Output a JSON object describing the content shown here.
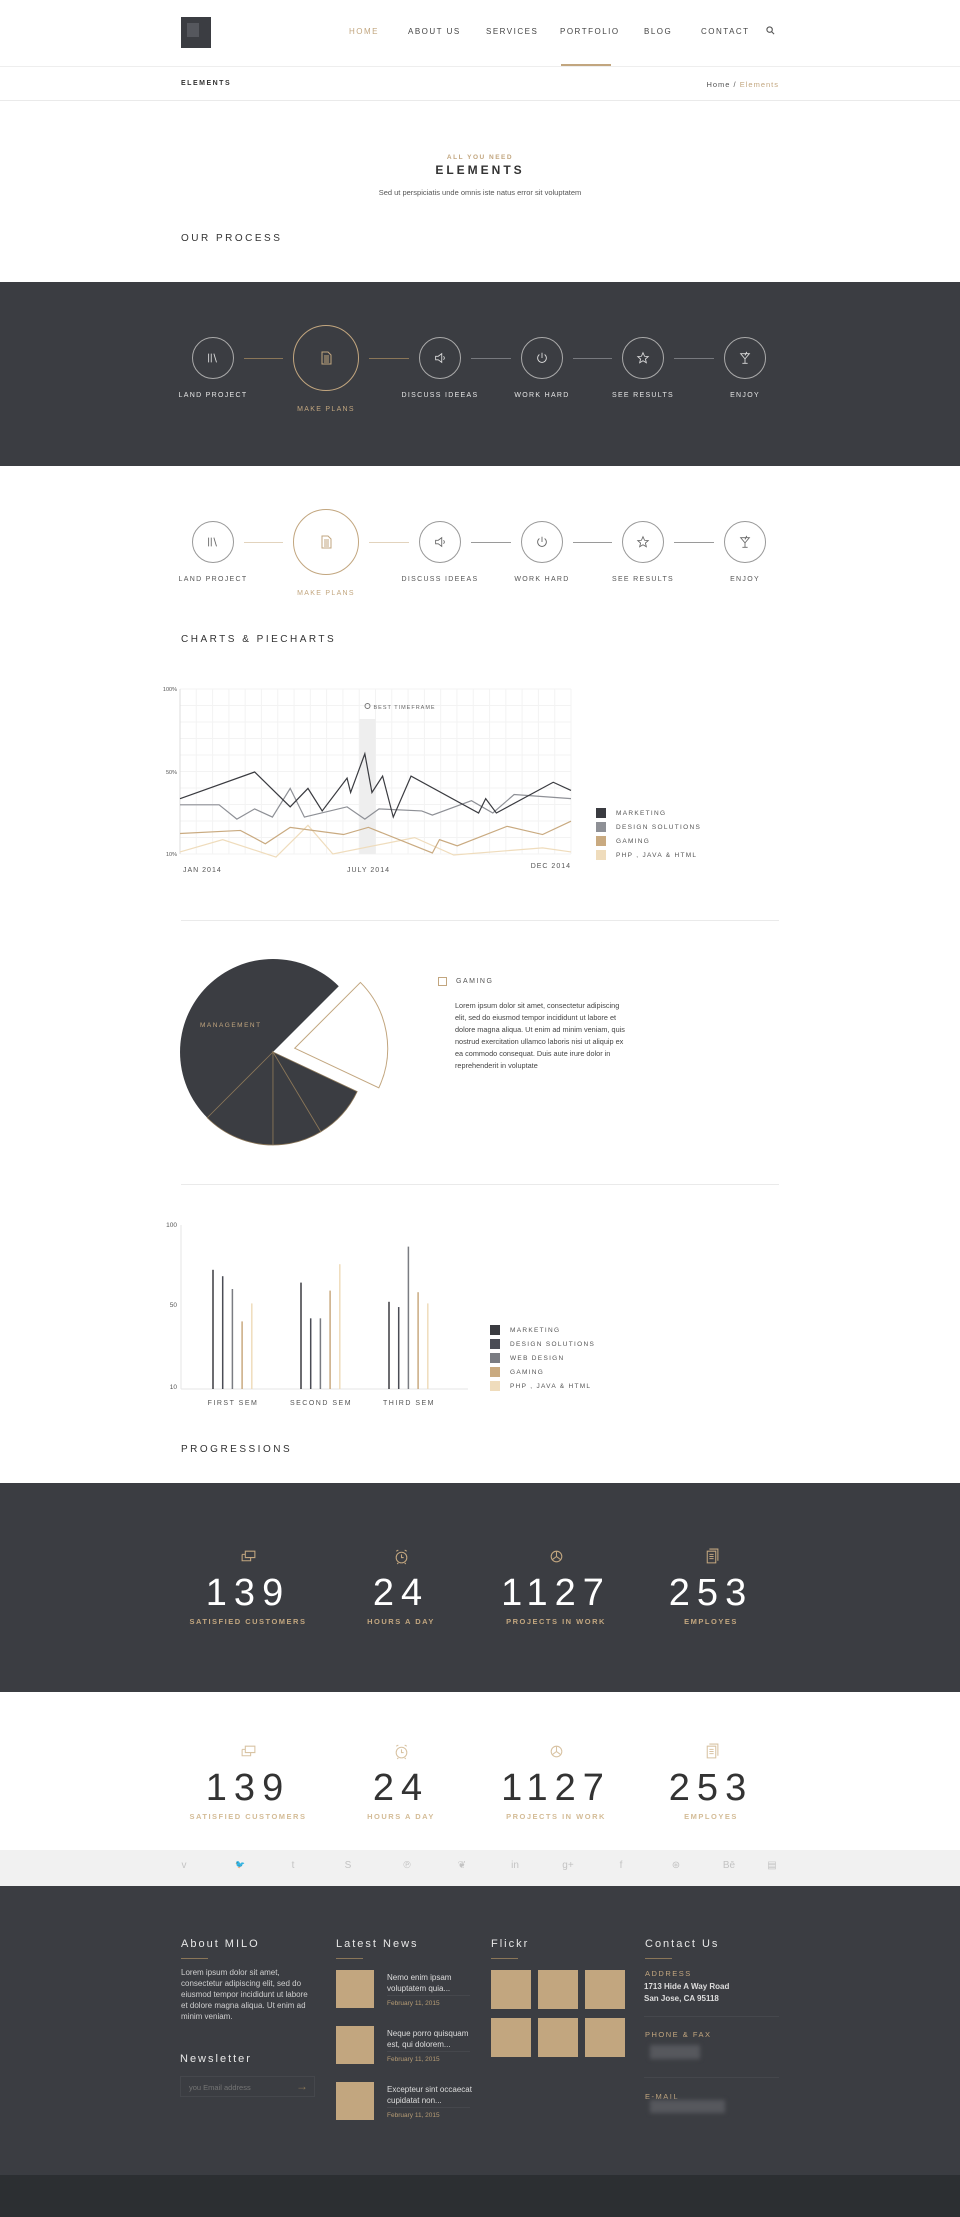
{
  "header": {
    "nav": [
      {
        "label": "HOME",
        "active": true
      },
      {
        "label": "ABOUT US"
      },
      {
        "label": "SERVICES"
      },
      {
        "label": "PORTFOLIO",
        "underlined": true
      },
      {
        "label": "BLOG"
      },
      {
        "label": "CONTACT"
      }
    ],
    "search_icon": "search-icon"
  },
  "breadcrumb": {
    "title": "ELEMENTS",
    "home": "Home",
    "separator": " / ",
    "current": "Elements"
  },
  "hero": {
    "kicker": "ALL YOU NEED",
    "title": "ELEMENTS",
    "subtitle": "Sed ut perspiciatis unde omnis iste natus error sit voluptatem"
  },
  "process": {
    "title": "OUR PROCESS",
    "steps": [
      {
        "label": "LAND PROJECT",
        "icon": "books-icon"
      },
      {
        "label": "MAKE PLANS",
        "icon": "document-icon",
        "active": true
      },
      {
        "label": "DISCUSS IDEEAS",
        "icon": "speaker-icon"
      },
      {
        "label": "WORK HARD",
        "icon": "power-icon"
      },
      {
        "label": "SEE RESULTS",
        "icon": "star-icon"
      },
      {
        "label": "ENJOY",
        "icon": "cocktail-icon"
      }
    ]
  },
  "charts_title": "CHARTS & PIECHARTS",
  "colors": {
    "dark": "#3b3d42",
    "accent": "#c2a67f",
    "marketing": "#3a3b40",
    "design": "#8e9096",
    "gaming": "#c9aa80",
    "php": "#efdcbc"
  },
  "chart_data": [
    {
      "type": "line",
      "ylabels": [
        "100%",
        "50%",
        "10%"
      ],
      "yticks": [
        100,
        50,
        10
      ],
      "xlabels": [
        "JAN 2014",
        "JULY 2014",
        "DEC 2014"
      ],
      "xlim": [
        0,
        11
      ],
      "grid": true,
      "legend": "right",
      "annotation": {
        "label": "BEST TIMEFRAME",
        "x_range": [
          5.05,
          5.5
        ]
      },
      "series": [
        {
          "name": "MARKETING",
          "color": "#3a3b40",
          "x": [
            0,
            2.1,
            3.1,
            3.6,
            4.0,
            4.7,
            4.8,
            5.2,
            5.4,
            5.7,
            6.0,
            6.5,
            8.4,
            8.6,
            8.9,
            10.5,
            11
          ],
          "y": [
            37,
            50,
            33,
            42,
            31,
            47,
            40,
            61,
            40,
            48,
            28,
            48,
            30,
            37,
            30,
            45,
            41
          ]
        },
        {
          "name": "DESIGN SOLUTIONS",
          "color": "#8e9096",
          "x": [
            0,
            1.1,
            1.6,
            2.1,
            2.6,
            3.1,
            3.5,
            4.7,
            5.2,
            5.6,
            6.8,
            7.1,
            8.2,
            8.8,
            9.4,
            11
          ],
          "y": [
            34,
            34,
            27,
            32,
            28,
            42,
            28,
            33,
            27,
            32,
            31,
            29,
            36,
            30,
            39,
            37
          ]
        },
        {
          "name": "GAMING",
          "color": "#c9aa80",
          "x": [
            0,
            1.7,
            2.4,
            3.1,
            4.6,
            5.3,
            7.1,
            7.3,
            7.8,
            9.2,
            10.2,
            11
          ],
          "y": [
            20,
            21.5,
            15,
            23,
            19.5,
            23,
            10.5,
            17,
            14,
            23.5,
            19.5,
            26
          ]
        },
        {
          "name": "PHP , JAVA & HTML",
          "color": "#efdcbc",
          "x": [
            0,
            1.2,
            2.7,
            3.6,
            4.3,
            6.6,
            7.7,
            10.2,
            11
          ],
          "y": [
            11,
            17,
            8.5,
            24,
            10,
            18,
            9.5,
            13,
            11
          ]
        }
      ]
    },
    {
      "type": "pie",
      "slices": [
        {
          "label": "MANAGEMENT",
          "value": 50,
          "color": "#3b3d42"
        },
        {
          "label": "",
          "value": 12.5,
          "color": "#3b3d42"
        },
        {
          "label": "",
          "value": 8.6,
          "color": "#3b3d42"
        },
        {
          "label": "",
          "value": 9.4,
          "color": "#3b3d42"
        },
        {
          "label": "GAMING",
          "value": 19.5,
          "color": "#ffffff",
          "exploded": true
        }
      ],
      "legend": {
        "label": "GAMING",
        "text": "Lorem ipsum dolor sit amet, consectetur adipiscing elit, sed do eiusmod tempor incididunt ut labore et dolore magna aliqua. Ut enim ad minim veniam, quis nostrud exercitation ullamco laboris nisi ut aliquip ex ea commodo consequat. Duis aute irure dolor in reprehenderit in voluptate"
      }
    },
    {
      "type": "bar",
      "categories": [
        "FIRST SEM",
        "SECOND SEM",
        "THIRD SEM"
      ],
      "ylabels": [
        "100",
        "50",
        "10"
      ],
      "yticks": [
        100,
        50,
        10
      ],
      "legend": "right",
      "series": [
        {
          "name": "MARKETING",
          "color": "#3a3b40",
          "values": [
            72,
            64,
            52
          ]
        },
        {
          "name": "DESIGN SOLUTIONS",
          "color": "#4a4c55",
          "values": [
            68,
            43.5,
            49
          ]
        },
        {
          "name": "WEB DESIGN",
          "color": "#7a7c82",
          "values": [
            60,
            43.5,
            86.5
          ]
        },
        {
          "name": "GAMING",
          "color": "#c9aa80",
          "values": [
            42,
            59,
            58
          ]
        },
        {
          "name": "PHP , JAVA & HTML",
          "color": "#efdcbc",
          "values": [
            51,
            75.5,
            51
          ]
        }
      ]
    }
  ],
  "progressions": {
    "title": "PROGRESSIONS",
    "stats": [
      {
        "value": "139",
        "label": "SATISFIED CUSTOMERS",
        "icon": "chat-icon"
      },
      {
        "value": "24",
        "label": "HOURS A DAY",
        "icon": "alarm-clock-icon"
      },
      {
        "value": "1127",
        "label": "PROJECTS IN WORK",
        "icon": "gear-icon"
      },
      {
        "value": "253",
        "label": "EMPLOYES",
        "icon": "documents-icon"
      }
    ]
  },
  "social": [
    {
      "icon": "vimeo-icon",
      "glyph": "v"
    },
    {
      "icon": "twitter-icon",
      "glyph": "🐦"
    },
    {
      "icon": "tumblr-icon",
      "glyph": "t"
    },
    {
      "icon": "skype-icon",
      "glyph": "S"
    },
    {
      "icon": "pinterest-icon",
      "glyph": "℗"
    },
    {
      "icon": "evernote-icon",
      "glyph": "❦"
    },
    {
      "icon": "linkedin-icon",
      "glyph": "in"
    },
    {
      "icon": "googleplus-icon",
      "glyph": "g+"
    },
    {
      "icon": "facebook-icon",
      "glyph": "f"
    },
    {
      "icon": "dribbble-icon",
      "glyph": "⊛"
    },
    {
      "icon": "behance-icon",
      "glyph": "Bē"
    },
    {
      "icon": "youtube-icon",
      "glyph": "▤"
    }
  ],
  "footer": {
    "about": {
      "title": "About MILO",
      "text": "Lorem ipsum dolor sit amet, consectetur adipiscing elit, sed do eiusmod tempor incididunt ut labore et dolore magna aliqua. Ut enim ad minim veniam."
    },
    "newsletter": {
      "title": "Newsletter",
      "placeholder": "you Email address"
    },
    "news": {
      "title": "Latest News",
      "items": [
        {
          "title": "Nemo enim ipsam voluptatem quia...",
          "date": "February 11, 2015"
        },
        {
          "title": "Neque porro quisquam est, qui dolorem...",
          "date": "February 11, 2015"
        },
        {
          "title": "Excepteur sint occaecat cupidatat non...",
          "date": "February 11, 2015"
        }
      ]
    },
    "flickr": {
      "title": "Flickr"
    },
    "contact": {
      "title": "Contact Us",
      "address_label": "ADDRESS",
      "address_1": "1713 Hide A Way Road",
      "address_2": "San Jose, CA 95118",
      "phone_label": "PHONE & FAX",
      "email_label": "E-MAIL"
    }
  }
}
